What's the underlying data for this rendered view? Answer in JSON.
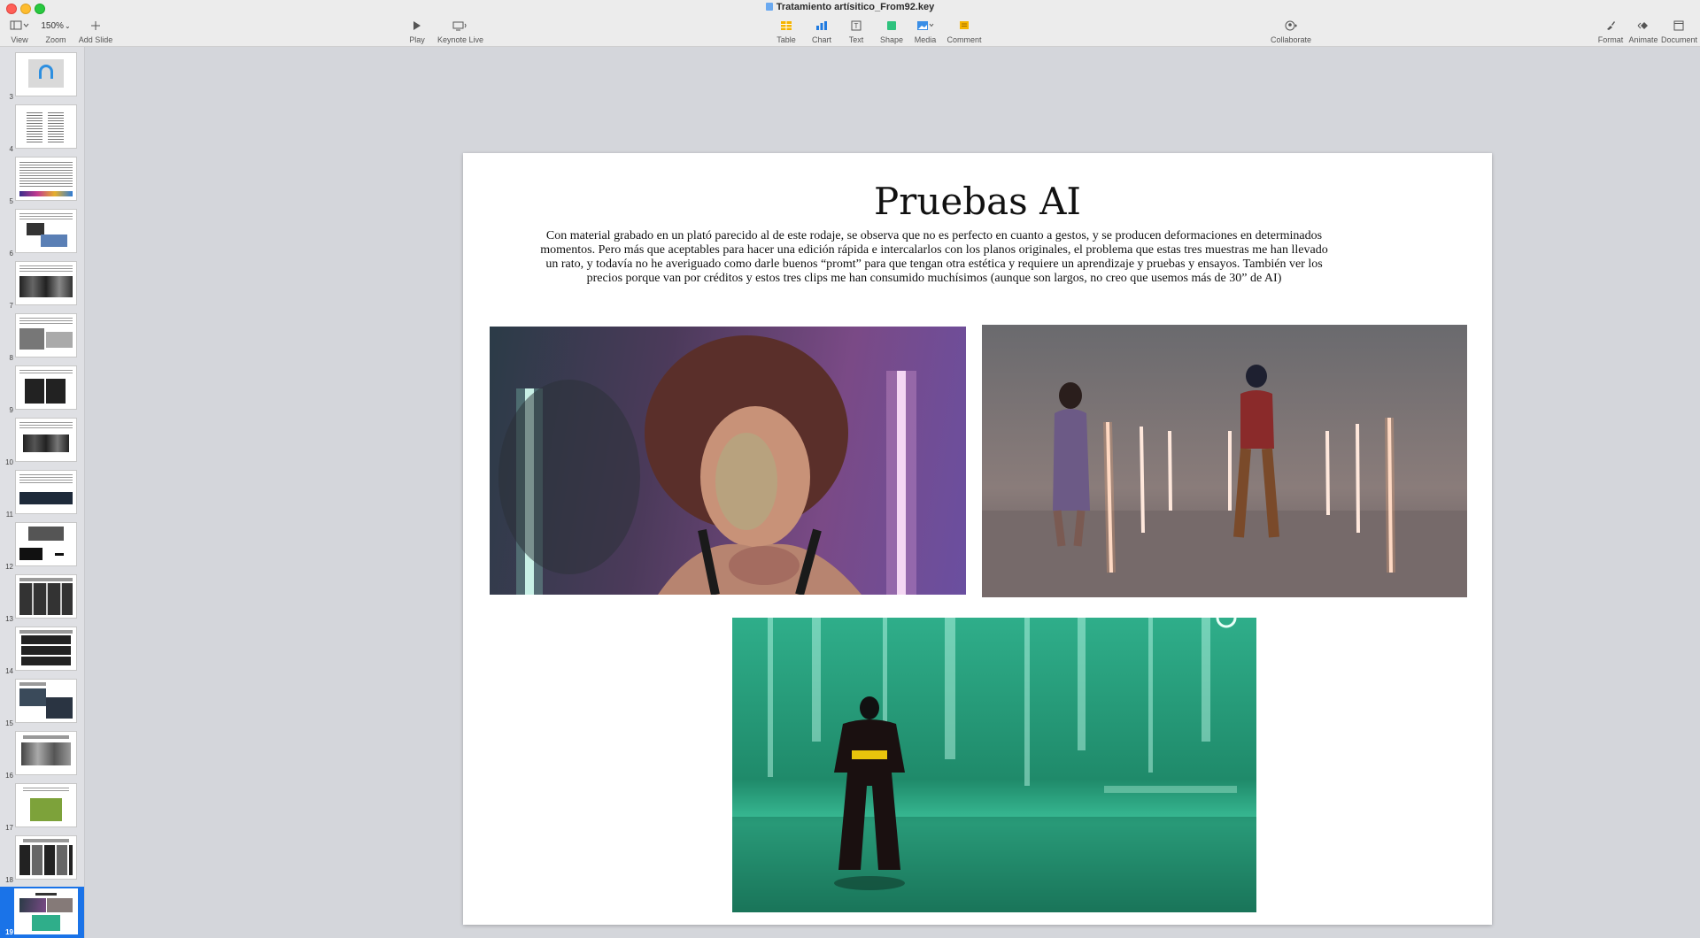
{
  "window": {
    "title": "Tratamiento artísitico_From92.key"
  },
  "toolbar": {
    "view_label": "View",
    "zoom_value": "150%",
    "zoom_label": "Zoom",
    "add_slide_label": "Add Slide",
    "play_label": "Play",
    "keynote_live_label": "Keynote Live",
    "table_label": "Table",
    "chart_label": "Chart",
    "text_label": "Text",
    "shape_label": "Shape",
    "media_label": "Media",
    "comment_label": "Comment",
    "collaborate_label": "Collaborate",
    "format_label": "Format",
    "animate_label": "Animate",
    "document_label": "Document"
  },
  "sidebar": {
    "slide_numbers": [
      "3",
      "4",
      "5",
      "6",
      "7",
      "8",
      "9",
      "10",
      "11",
      "12",
      "13",
      "14",
      "15",
      "16",
      "17",
      "18",
      "19"
    ],
    "selected": "19"
  },
  "slide": {
    "title": "Pruebas AI",
    "body": "Con material grabado en un plató parecido al de este rodaje, se observa que no es perfecto en cuanto a gestos, y se producen deformaciones en determinados momentos. Pero más que aceptables para hacer una edición rápida e intercalarlos con los planos originales, el problema que estas tres muestras me han llevado un rato, y todavía no he averiguado como darle buenos “promt” para que tengan otra estética y requiere un aprendizaje y pruebas y ensayos. También ver los precios porque van por créditos y estos tres clips me han consumido muchísimos (aunque son largos, no creo que usemos más de 30” de AI)"
  },
  "colors": {
    "selection": "#1a73e8",
    "canvas_bg": "#d4d6db",
    "toolbar_bg": "#ececec"
  }
}
